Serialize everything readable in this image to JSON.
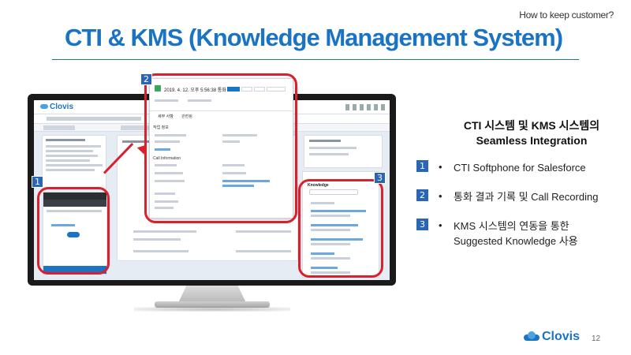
{
  "slide": {
    "top_tag": "How to keep customer?",
    "title": "CTI & KMS (Knowledge Management System)",
    "heading_line1": "CTI 시스템 및 KMS 시스템의",
    "heading_line2": "Seamless Integration",
    "bullets": [
      {
        "num": "1",
        "text": "CTI Softphone  for Salesforce"
      },
      {
        "num": "2",
        "text": "통화 결과 기록 및 Call Recording"
      },
      {
        "num": "3",
        "text": "KMS 시스템의 연동을 통한",
        "text2": "Suggested  Knowledge 사용"
      }
    ],
    "bullet_marker": "•",
    "footer_brand": "Clovis",
    "page_number": "12"
  },
  "screen": {
    "brand": "Clovis",
    "popup_datetime": "2019. 4. 12. 오후 5:56:38 통화",
    "popup_tab1": "세부 사항",
    "popup_tab2": "관련됨",
    "popup_section1": "작업 정보",
    "popup_section2": "Call Information",
    "knowledge_title": "Knowledge"
  },
  "callouts": [
    "1",
    "2",
    "3"
  ],
  "colors": {
    "title_blue": "#1b73c4",
    "badge_blue": "#2b66b5",
    "callout_red": "#d9202c"
  }
}
